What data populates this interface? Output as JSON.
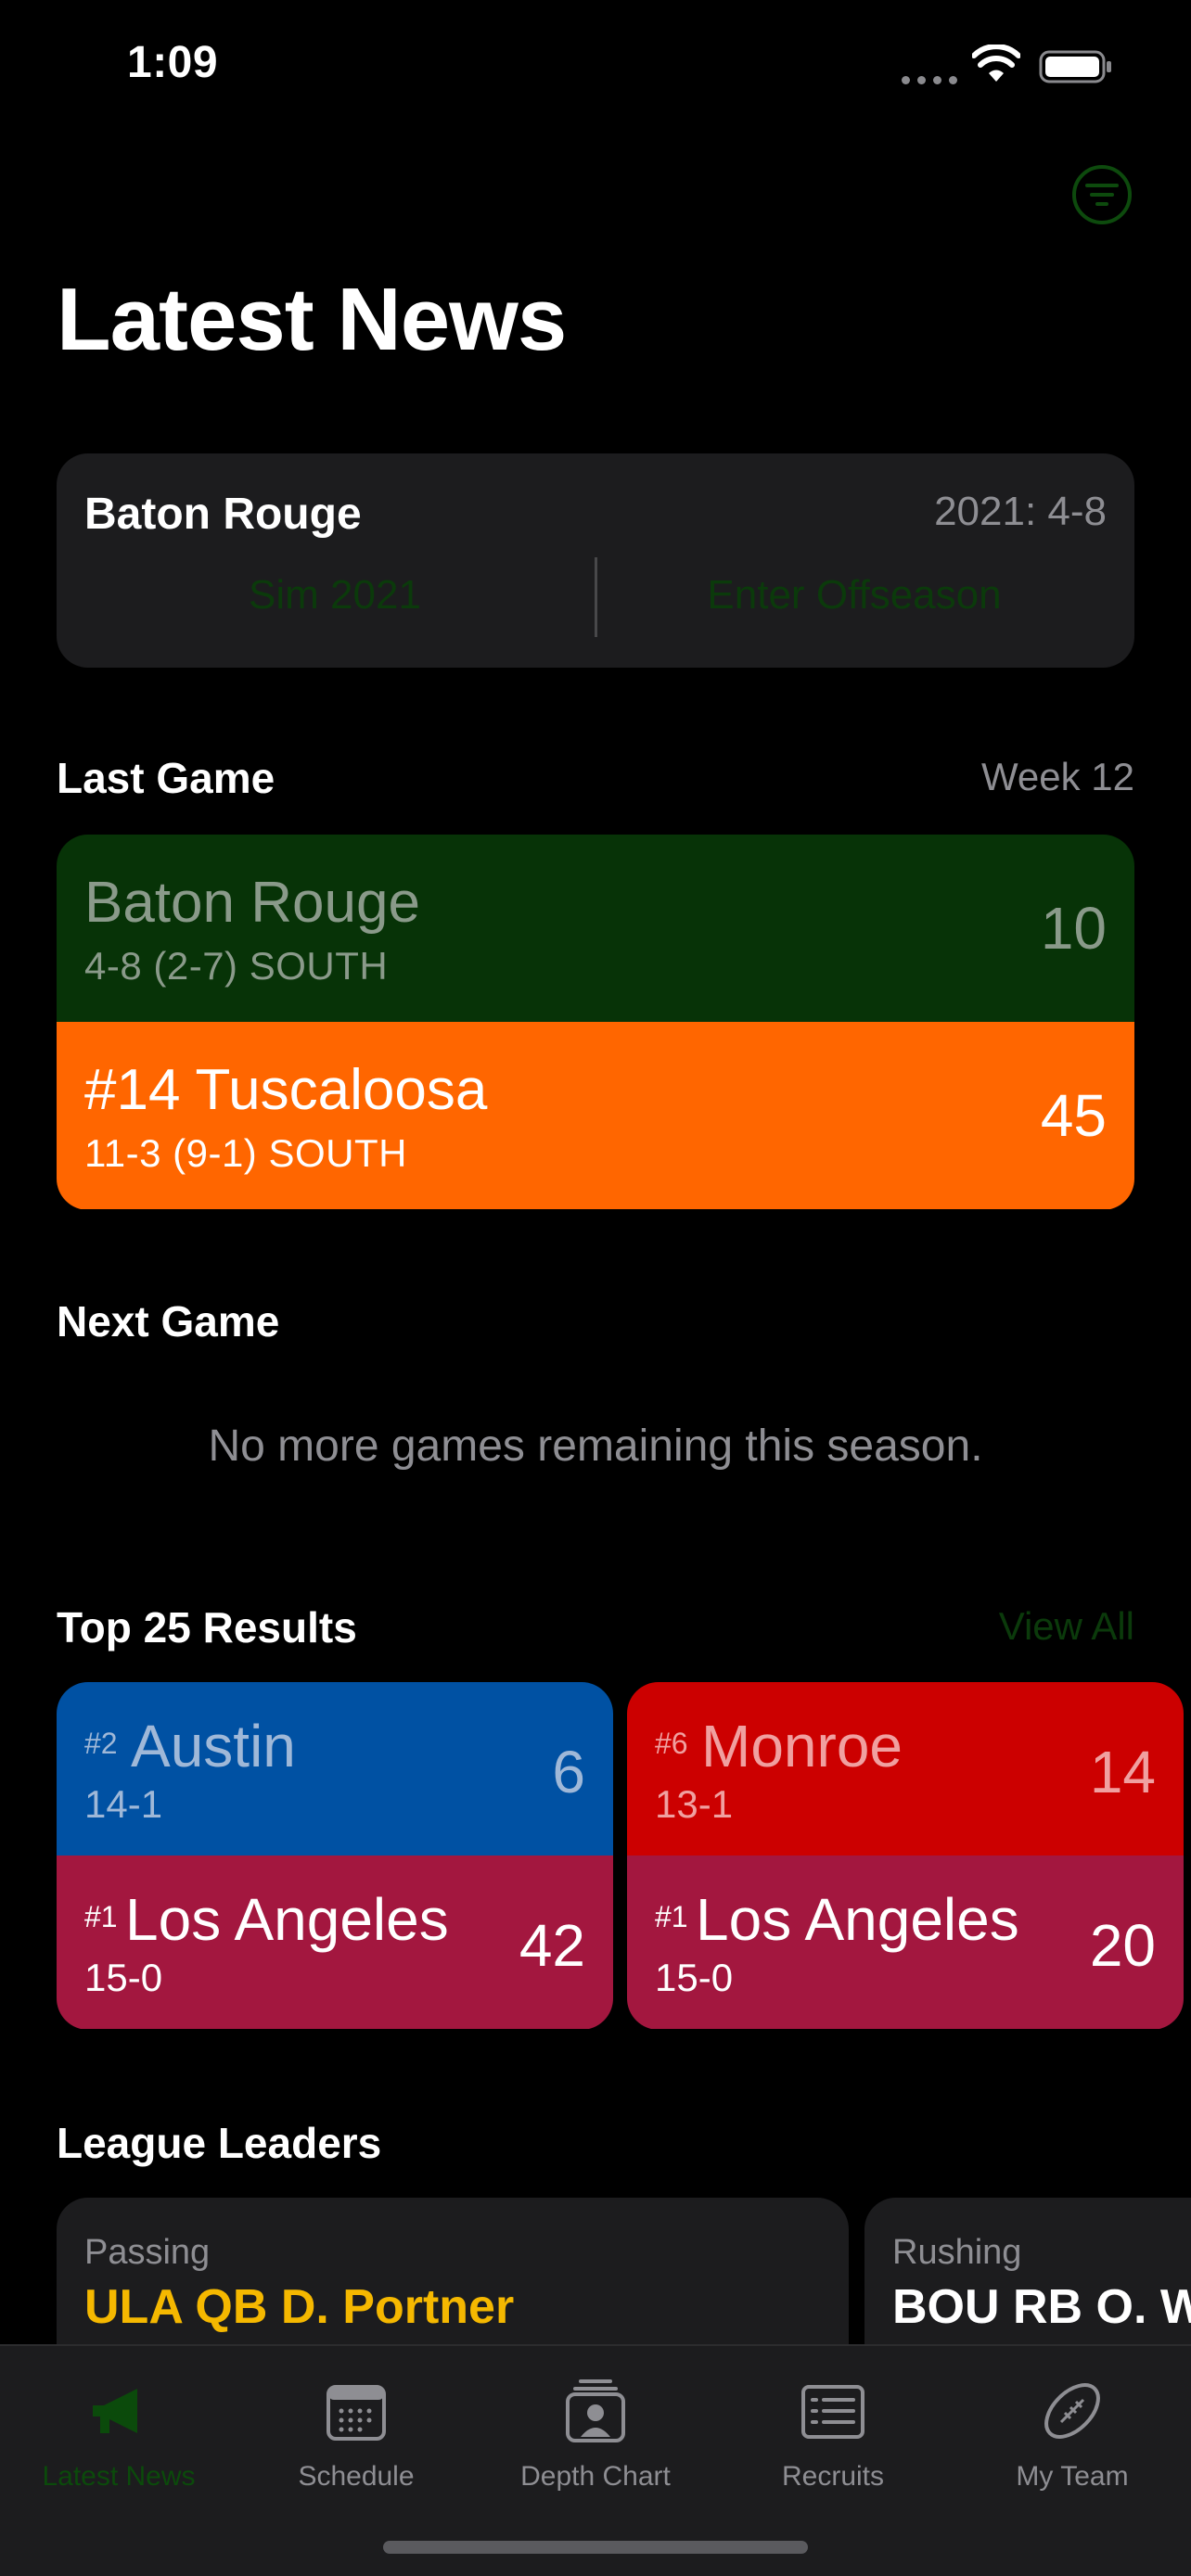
{
  "status": {
    "time": "1:09"
  },
  "page": {
    "title": "Latest News"
  },
  "team_card": {
    "team": "Baton Rouge",
    "record": "2021: 4-8",
    "left_action": "Sim 2021",
    "right_action": "Enter Offseason"
  },
  "last_game": {
    "title": "Last Game",
    "week": "Week 12",
    "away": {
      "name": "Baton Rouge",
      "sub": "4-8 (2-7) SOUTH",
      "score": "10",
      "color": "#073307",
      "text_color": "#8a9a8a"
    },
    "home": {
      "name": "#14 Tuscaloosa",
      "sub": "11-3 (9-1) SOUTH",
      "score": "45",
      "color": "#ff6600",
      "text_color": "#ffffff"
    }
  },
  "next_game": {
    "title": "Next Game",
    "empty_text": "No more games remaining this season."
  },
  "top25": {
    "title": "Top 25 Results",
    "view_all": "View All",
    "games": [
      {
        "top": {
          "rank": "#2",
          "name": "Austin",
          "record": "14-1",
          "score": "6",
          "color": "#0051a3",
          "text_color": "#9fb8d8"
        },
        "bottom": {
          "rank": "#1",
          "name": "Los Angeles",
          "record": "15-0",
          "score": "42",
          "color": "#a3173f",
          "text_color": "#ffffff"
        }
      },
      {
        "top": {
          "rank": "#6",
          "name": "Monroe",
          "record": "13-1",
          "score": "14",
          "color": "#cc0000",
          "text_color": "#f0a0a0"
        },
        "bottom": {
          "rank": "#1",
          "name": "Los Angeles",
          "record": "15-0",
          "score": "20",
          "color": "#a3173f",
          "text_color": "#ffffff"
        }
      }
    ]
  },
  "leaders": {
    "title": "League Leaders",
    "items": [
      {
        "category": "Passing",
        "name": "ULA QB D. Portner",
        "color": "#f5b800"
      },
      {
        "category": "Rushing",
        "name": "BOU RB O. We",
        "color": "#ffffff"
      }
    ]
  },
  "tabs": [
    {
      "label": "Latest News",
      "icon": "megaphone-icon",
      "active": true
    },
    {
      "label": "Schedule",
      "icon": "calendar-icon"
    },
    {
      "label": "Depth Chart",
      "icon": "depth-chart-icon"
    },
    {
      "label": "Recruits",
      "icon": "list-icon"
    },
    {
      "label": "My Team",
      "icon": "football-icon"
    }
  ],
  "colors": {
    "accent": "#0b5a0b",
    "card": "#1c1c1e",
    "secondary_text": "#8e8e93"
  }
}
